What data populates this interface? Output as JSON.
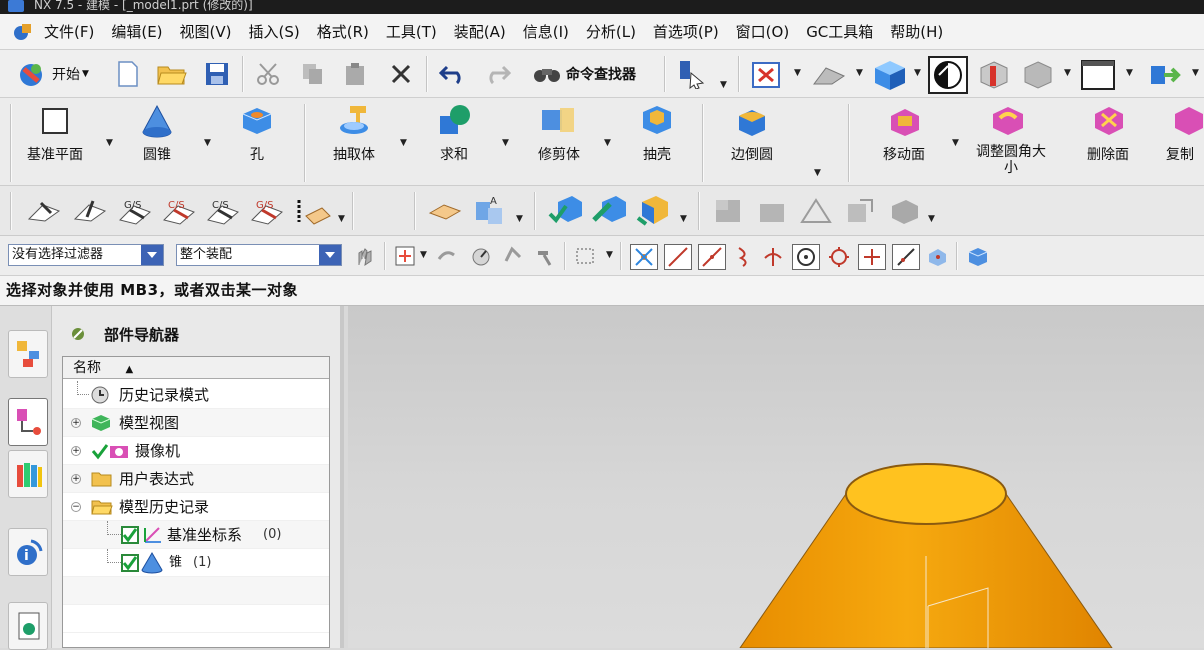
{
  "window": {
    "title": "NX 7.5 - 建模 - [_model1.prt (修改的)]"
  },
  "menubar": {
    "items": [
      "文件(F)",
      "编辑(E)",
      "视图(V)",
      "插入(S)",
      "格式(R)",
      "工具(T)",
      "装配(A)",
      "信息(I)",
      "分析(L)",
      "首选项(P)",
      "窗口(O)",
      "GC工具箱",
      "帮助(H)"
    ]
  },
  "toolbar_standard": {
    "start_label": "开始",
    "command_finder_label": "命令查找器"
  },
  "toolbar_features": {
    "buttons": [
      {
        "label": "基准平面",
        "icon": "datum-plane-icon"
      },
      {
        "label": "圆锥",
        "icon": "cone-icon"
      },
      {
        "label": "孔",
        "icon": "hole-icon"
      },
      {
        "label": "抽取体",
        "icon": "extract-body-icon"
      },
      {
        "label": "求和",
        "icon": "unite-icon"
      },
      {
        "label": "修剪体",
        "icon": "trim-body-icon"
      },
      {
        "label": "抽壳",
        "icon": "shell-icon"
      },
      {
        "label": "边倒圆",
        "icon": "edge-blend-icon"
      },
      {
        "label": "移动面",
        "icon": "move-face-icon"
      },
      {
        "label": "调整圆角大小",
        "icon": "resize-blend-icon"
      },
      {
        "label": "删除面",
        "icon": "delete-face-icon"
      },
      {
        "label": "复制",
        "icon": "copy-face-icon"
      }
    ]
  },
  "selection_bar": {
    "filter_value": "没有选择过滤器",
    "scope_value": "整个装配"
  },
  "status": {
    "prompt": "选择对象并使用 MB3，或者双击某一对象"
  },
  "navigator": {
    "title": "部件导航器",
    "column_header": "名称",
    "rows": [
      {
        "label": "历史记录模式",
        "suffix": ""
      },
      {
        "label": "模型视图",
        "suffix": ""
      },
      {
        "label": "摄像机",
        "suffix": ""
      },
      {
        "label": "用户表达式",
        "suffix": ""
      },
      {
        "label": "模型历史记录",
        "suffix": ""
      },
      {
        "label": "基准坐标系",
        "suffix": "(0)"
      },
      {
        "label": "锥",
        "suffix": "(1)"
      }
    ]
  },
  "colors": {
    "accent_blue": "#3c63b5",
    "cone_orange": "#f4a60e",
    "cone_top": "#ffc21f"
  }
}
